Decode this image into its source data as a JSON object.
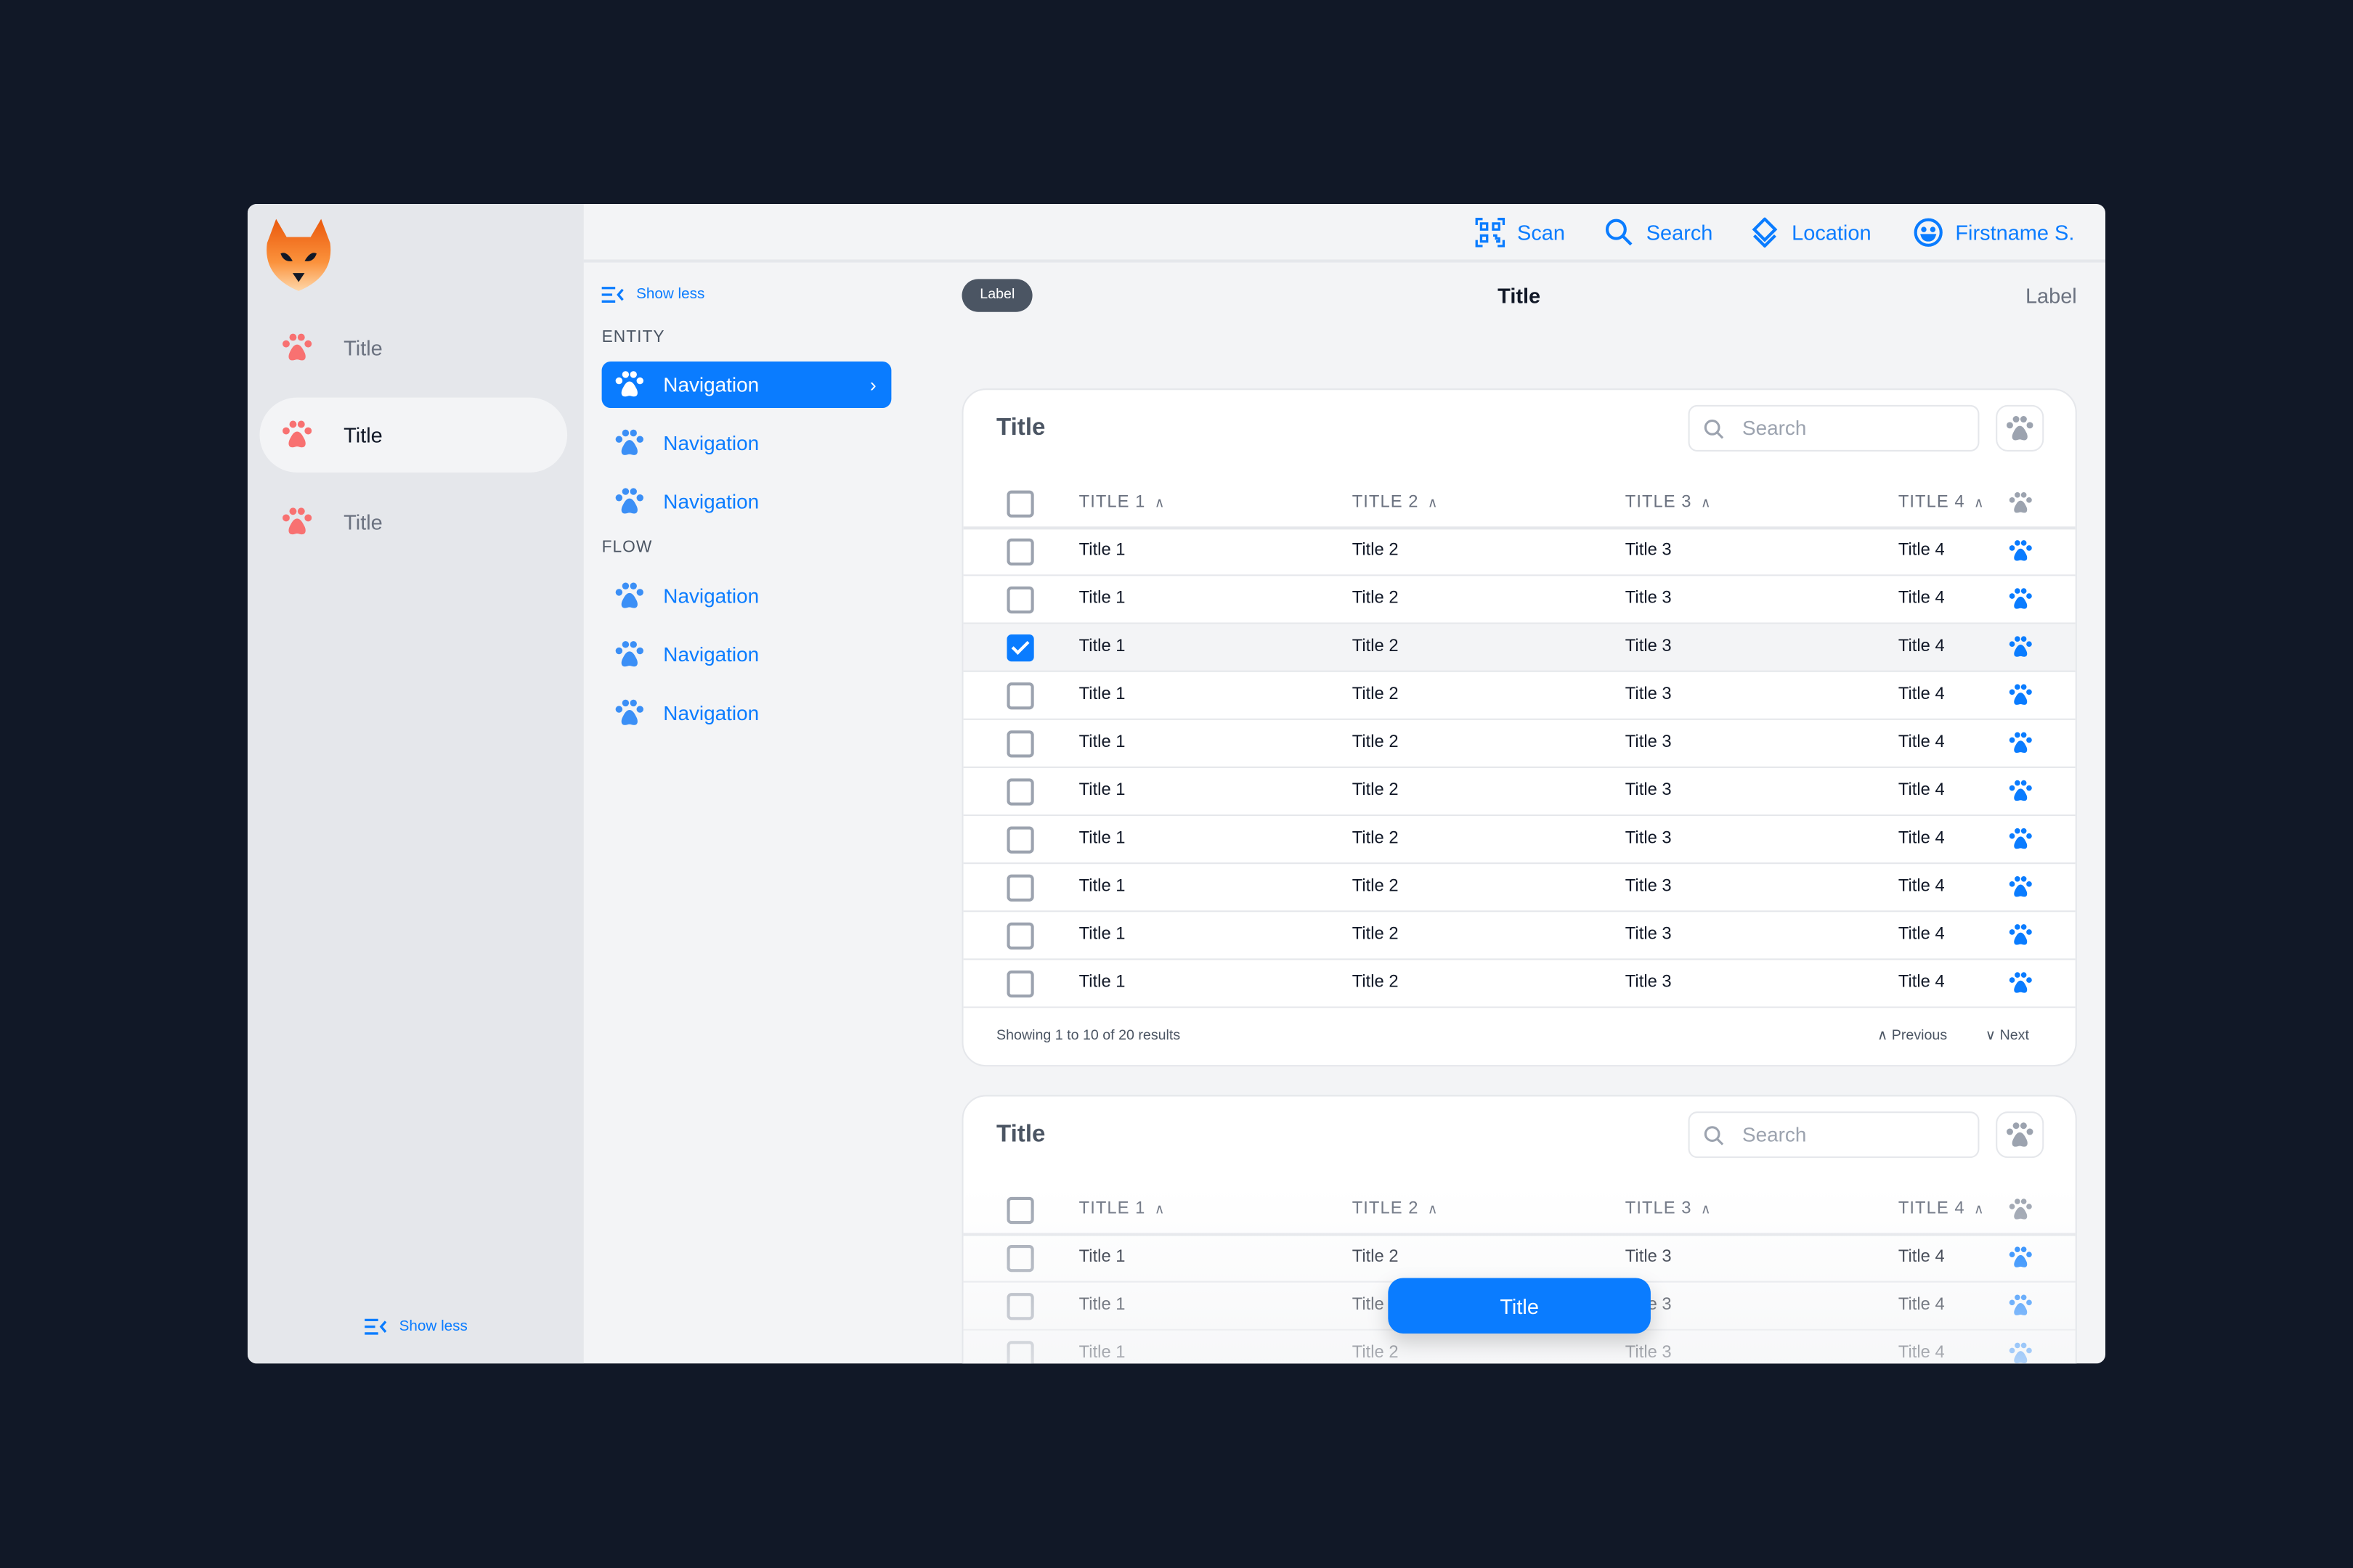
{
  "colors": {
    "accent": "#0a7cff",
    "rail_icon": "#f87171",
    "background": "#111827"
  },
  "rail": {
    "items": [
      {
        "label": "Title",
        "icon": "paw-icon"
      },
      {
        "label": "Title",
        "icon": "paw-icon",
        "active": true
      },
      {
        "label": "Title",
        "icon": "paw-icon"
      }
    ],
    "show_less": "Show less"
  },
  "topbar": {
    "scan": "Scan",
    "search": "Search",
    "location": "Location",
    "user": "Firstname S."
  },
  "nav": {
    "show_less": "Show less",
    "sections": [
      {
        "label": "ENTITY",
        "items": [
          "Navigation",
          "Navigation",
          "Navigation"
        ]
      },
      {
        "label": "FLOW",
        "items": [
          "Navigation",
          "Navigation",
          "Navigation"
        ]
      }
    ]
  },
  "page": {
    "badge": "Label",
    "title": "Title",
    "label": "Label"
  },
  "table1": {
    "title": "Title",
    "search_placeholder": "Search",
    "headers": [
      "TITLE 1",
      "TITLE 2",
      "TITLE 3",
      "TITLE 4"
    ],
    "rows": [
      [
        "Title 1",
        "Title 2",
        "Title 3",
        "Title 4"
      ],
      [
        "Title 1",
        "Title 2",
        "Title 3",
        "Title 4"
      ],
      [
        "Title 1",
        "Title 2",
        "Title 3",
        "Title 4"
      ],
      [
        "Title 1",
        "Title 2",
        "Title 3",
        "Title 4"
      ],
      [
        "Title 1",
        "Title 2",
        "Title 3",
        "Title 4"
      ],
      [
        "Title 1",
        "Title 2",
        "Title 3",
        "Title 4"
      ],
      [
        "Title 1",
        "Title 2",
        "Title 3",
        "Title 4"
      ],
      [
        "Title 1",
        "Title 2",
        "Title 3",
        "Title 4"
      ],
      [
        "Title 1",
        "Title 2",
        "Title 3",
        "Title 4"
      ],
      [
        "Title 1",
        "Title 2",
        "Title 3",
        "Title 4"
      ]
    ],
    "selected_row": 2,
    "footer": "Showing 1 to 10 of 20 results",
    "previous": "Previous",
    "next": "Next"
  },
  "table2": {
    "title": "Title",
    "search_placeholder": "Search",
    "headers": [
      "TITLE 1",
      "TITLE 2",
      "TITLE 3",
      "TITLE 4"
    ],
    "rows": [
      [
        "Title 1",
        "Title 2",
        "Title 3",
        "Title 4"
      ],
      [
        "Title 1",
        "Title 2",
        "Title 3",
        "Title 4"
      ],
      [
        "Title 1",
        "Title 2",
        "Title 3",
        "Title 4"
      ]
    ]
  },
  "fab": {
    "label": "Title"
  }
}
